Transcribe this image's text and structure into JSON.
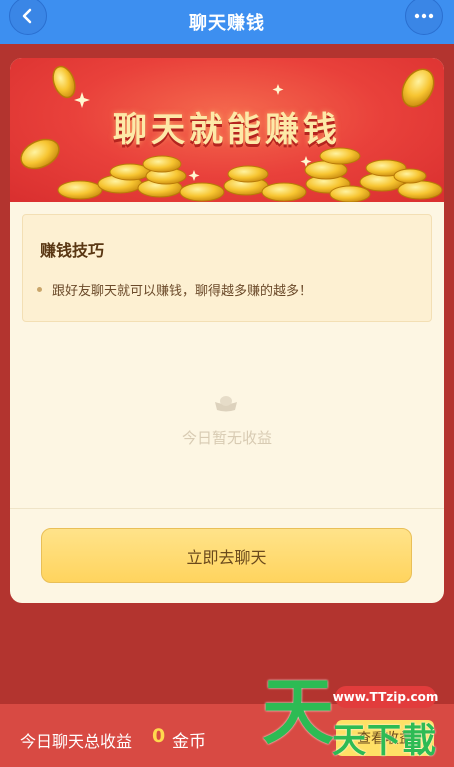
{
  "header": {
    "title": "聊天赚钱",
    "back_icon": "chevron-left-icon",
    "more_icon": "more-dots-icon"
  },
  "banner": {
    "title": "聊天就能赚钱"
  },
  "tips": {
    "title": "赚钱技巧",
    "items": [
      "跟好友聊天就可以赚钱，聊得越多赚的越多！"
    ]
  },
  "empty_state": {
    "icon": "ingot-icon",
    "text": "今日暂无收益"
  },
  "cta": {
    "label": "立即去聊天"
  },
  "bottom_bar": {
    "label": "今日聊天总收益",
    "amount": "0",
    "unit": "金币",
    "view_button": "查看收益"
  },
  "watermark": {
    "url": "www.TTzip.com",
    "big_char": "天",
    "small_text": "天下載"
  },
  "colors": {
    "header_blue": "#3d8ff0",
    "page_red": "#b3342f",
    "card_cream": "#fdf6e3",
    "button_yellow": "#ffd45e",
    "bottom_red": "#d84a43",
    "amount_yellow": "#ffd84e",
    "watermark_green": "#2dbb54"
  }
}
